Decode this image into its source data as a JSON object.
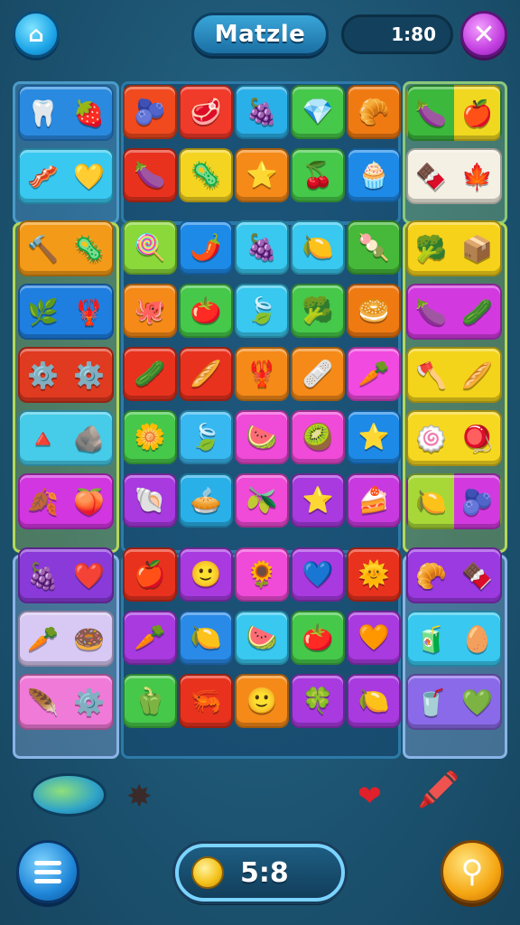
{
  "header": {
    "home_icon": "home-icon",
    "title": "Matzle",
    "timer": "1:80",
    "close_icon": "close-icon"
  },
  "board": {
    "left_column": [
      {
        "color": "#2a8ae0",
        "items": [
          "🦷",
          "🍓"
        ]
      },
      {
        "color": "#38c8f0",
        "items": [
          "🥓",
          "💛"
        ]
      },
      {
        "color": "#f39a18",
        "items": [
          "🔨",
          "🦠"
        ]
      },
      {
        "color": "#1e7fe0",
        "items": [
          "🌿",
          "🦞"
        ]
      },
      {
        "color": "#e03a20",
        "items": [
          "⚙️",
          "⚙️"
        ]
      },
      {
        "color": "#46cbe8",
        "items": [
          "🔺",
          "🪨"
        ]
      },
      {
        "color": "#d236e0",
        "items": [
          "🍂",
          "🍑"
        ]
      },
      {
        "color": "#8a3ad8",
        "items": [
          "🍇",
          "❤️"
        ]
      },
      {
        "color": "#d8c8f4",
        "items": [
          "🥕",
          "🍩"
        ]
      },
      {
        "color": "#f07ad8",
        "items": [
          "🪶",
          "⚙️"
        ]
      }
    ],
    "right_column": [
      {
        "colors": [
          "#3cb83c",
          "#f0d820"
        ],
        "items": [
          "🍆",
          "🍎"
        ]
      },
      {
        "color": "#f4f0e4",
        "items": [
          "🍫",
          "🍁"
        ]
      },
      {
        "color": "#f6d21a",
        "items": [
          "🥦",
          "📦"
        ]
      },
      {
        "color": "#d23ae0",
        "items": [
          "🍆",
          "🥒"
        ]
      },
      {
        "color": "#f4d41a",
        "items": [
          "🪓",
          "🥖"
        ]
      },
      {
        "color": "#f6d820",
        "items": [
          "🍥",
          "🪀"
        ]
      },
      {
        "colors": [
          "#a8d838",
          "#d23ae0"
        ],
        "items": [
          "🍋",
          "🫐"
        ]
      },
      {
        "color": "#9a3ae0",
        "items": [
          "🥐",
          "🍫"
        ]
      },
      {
        "color": "#38c8f0",
        "items": [
          "🧃",
          "🥚"
        ]
      },
      {
        "color": "#8a6ae8",
        "items": [
          "🥤",
          "💚"
        ]
      }
    ],
    "center_rows": [
      [
        {
          "color": "#f04a1e",
          "glyph": "🫐"
        },
        {
          "color": "#f03a2a",
          "glyph": "🥩"
        },
        {
          "color": "#2ab0e8",
          "glyph": "🍇"
        },
        {
          "color": "#46c84a",
          "glyph": "💎"
        },
        {
          "color": "#f07a12",
          "glyph": "🥐"
        }
      ],
      [
        {
          "color": "#e8321e",
          "glyph": "🍆"
        },
        {
          "color": "#f4d420",
          "glyph": "🦠"
        },
        {
          "color": "#f58a18",
          "glyph": "⭐"
        },
        {
          "color": "#46c84a",
          "glyph": "🍒"
        },
        {
          "color": "#1e8ae8",
          "glyph": "🧁"
        }
      ],
      [
        {
          "color": "#8ad83a",
          "glyph": "🍭"
        },
        {
          "color": "#1e8ae8",
          "glyph": "🌶️"
        },
        {
          "color": "#38c8f0",
          "glyph": "🍇"
        },
        {
          "color": "#38c8f0",
          "glyph": "🍋"
        },
        {
          "color": "#46b83a",
          "glyph": "🍡"
        }
      ],
      [
        {
          "color": "#f58a18",
          "glyph": "🐙"
        },
        {
          "color": "#46c84a",
          "glyph": "🍅"
        },
        {
          "color": "#38c8f0",
          "glyph": "🍃"
        },
        {
          "color": "#46c84a",
          "glyph": "🥦"
        },
        {
          "color": "#f07a12",
          "glyph": "🥯"
        }
      ],
      [
        {
          "color": "#e8321e",
          "glyph": "🥒"
        },
        {
          "color": "#e8321e",
          "glyph": "🥖"
        },
        {
          "color": "#f58a18",
          "glyph": "🦞"
        },
        {
          "color": "#f58a18",
          "glyph": "🩹"
        },
        {
          "color": "#f04ae0",
          "glyph": "🥕"
        }
      ],
      [
        {
          "color": "#46c84a",
          "glyph": "🌼"
        },
        {
          "color": "#38b8f0",
          "glyph": "🍃"
        },
        {
          "color": "#f04ad8",
          "glyph": "🍉"
        },
        {
          "color": "#f04ad8",
          "glyph": "🥝"
        },
        {
          "color": "#1e8ae8",
          "glyph": "⭐"
        }
      ],
      [
        {
          "color": "#a83ae0",
          "glyph": "🐚"
        },
        {
          "color": "#2ab0e8",
          "glyph": "🥧"
        },
        {
          "color": "#f04ad8",
          "glyph": "🫒"
        },
        {
          "color": "#a83ae0",
          "glyph": "⭐"
        },
        {
          "color": "#c83ae0",
          "glyph": "🍰"
        }
      ],
      [
        {
          "color": "#e8321e",
          "glyph": "🍎"
        },
        {
          "color": "#a83ae0",
          "glyph": "🙂"
        },
        {
          "color": "#f04ad8",
          "glyph": "🌻"
        },
        {
          "color": "#a83ae0",
          "glyph": "💙"
        },
        {
          "color": "#e8321e",
          "glyph": "🌞"
        }
      ],
      [
        {
          "color": "#a83ae0",
          "glyph": "🥕"
        },
        {
          "color": "#2a8ae8",
          "glyph": "🍋"
        },
        {
          "color": "#38c8f0",
          "glyph": "🍉"
        },
        {
          "color": "#46c84a",
          "glyph": "🍅"
        },
        {
          "color": "#a83ae0",
          "glyph": "🧡"
        }
      ],
      [
        {
          "color": "#46c84a",
          "glyph": "🫑"
        },
        {
          "color": "#e8321e",
          "glyph": "🦐"
        },
        {
          "color": "#f58a18",
          "glyph": "🙂"
        },
        {
          "color": "#a83ae0",
          "glyph": "🍀"
        },
        {
          "color": "#a83ae0",
          "glyph": "🍋"
        }
      ]
    ]
  },
  "bottom": {
    "score": "5:8",
    "menu_icon": "menu-icon",
    "coin_icon": "coin-icon",
    "hint_icon": "hint-icon",
    "map_icon": "map-icon",
    "splat_glyph": "✸",
    "heart_glyph": "❤",
    "crayon_glyph": "🖍️"
  }
}
